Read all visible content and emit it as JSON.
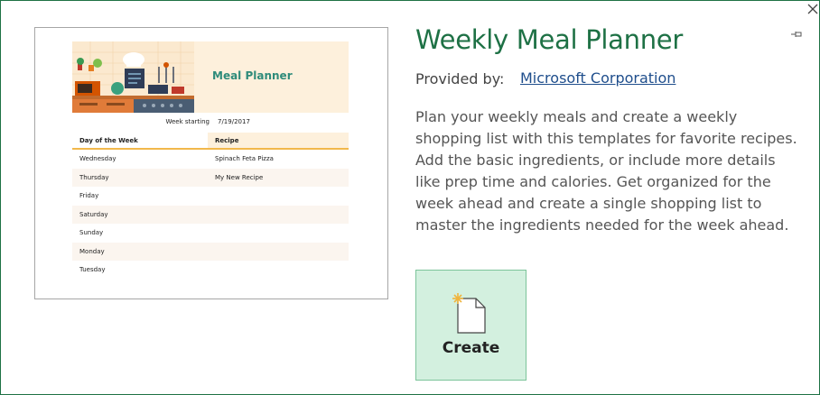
{
  "template": {
    "title": "Weekly Meal Planner",
    "provided_by_label": "Provided by:",
    "provider": "Microsoft Corporation",
    "description": "Plan your weekly meals and create a weekly shopping list with this templates for favorite recipes. Add the basic ingredients, or include more details like prep time and calories. Get organized for the week ahead and create a single shopping list to master the ingredients needed for the week ahead."
  },
  "preview": {
    "banner_title": "Meal Planner",
    "week_label": "Week starting",
    "week_value": "7/19/2017",
    "headers": [
      "Day of the Week",
      "Recipe"
    ],
    "rows": [
      [
        "Wednesday",
        "Spinach Feta Pizza"
      ],
      [
        "Thursday",
        "My New Recipe"
      ],
      [
        "Friday",
        ""
      ],
      [
        "Saturday",
        ""
      ],
      [
        "Sunday",
        ""
      ],
      [
        "Monday",
        ""
      ],
      [
        "Tuesday",
        ""
      ]
    ]
  },
  "actions": {
    "create_label": "Create"
  },
  "icons": {
    "close": "close-icon",
    "pin": "pin-icon",
    "new_document": "new-document-icon"
  },
  "colors": {
    "accent": "#1e7145",
    "link": "#1f4e8c",
    "create_bg": "#d3f0df",
    "header_rule": "#f2b84b"
  }
}
